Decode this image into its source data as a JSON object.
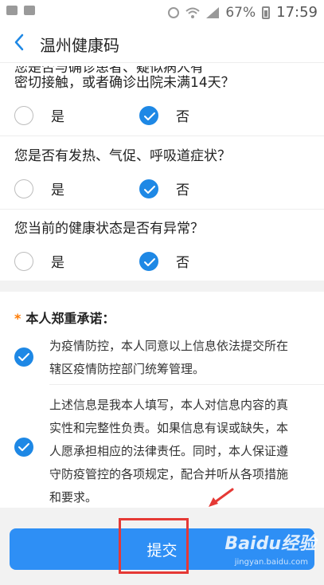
{
  "statusbar": {
    "battery_pct": "67%",
    "time": "17:59"
  },
  "nav": {
    "title": "温州健康码"
  },
  "q1": {
    "partial_line": "您是否与确诊患者、疑似病人有",
    "line2": "密切接触，或者确诊出院未满14天？"
  },
  "q2": {
    "text": "您是否有发热、气促、呼吸道症状？"
  },
  "q3": {
    "text": "您当前的健康状态是否有异常？"
  },
  "options": {
    "yes": "是",
    "no": "否"
  },
  "promise": {
    "star": "*",
    "title": "本人郑重承诺：",
    "item1": [
      "为疫情防控，本人同意以上信息依法提交所在",
      "辖区疫情防控部门统筹管理。"
    ],
    "item2": [
      "上述信息是我本人填写，本人对信息内容的真",
      "实性和完整性负责。如果信息有误或缺失，本",
      "人愿承担相应的法律责任。同时，本人保证遵",
      "守防疫管控的各项规定，配合并听从各项措施",
      "和要求。"
    ]
  },
  "submit": {
    "label": "提交"
  },
  "watermark": {
    "text": "Baidu经验",
    "sub": "jingyan.baidu.com"
  },
  "colors": {
    "accent": "#1e88e5",
    "highlight": "#e53935"
  }
}
